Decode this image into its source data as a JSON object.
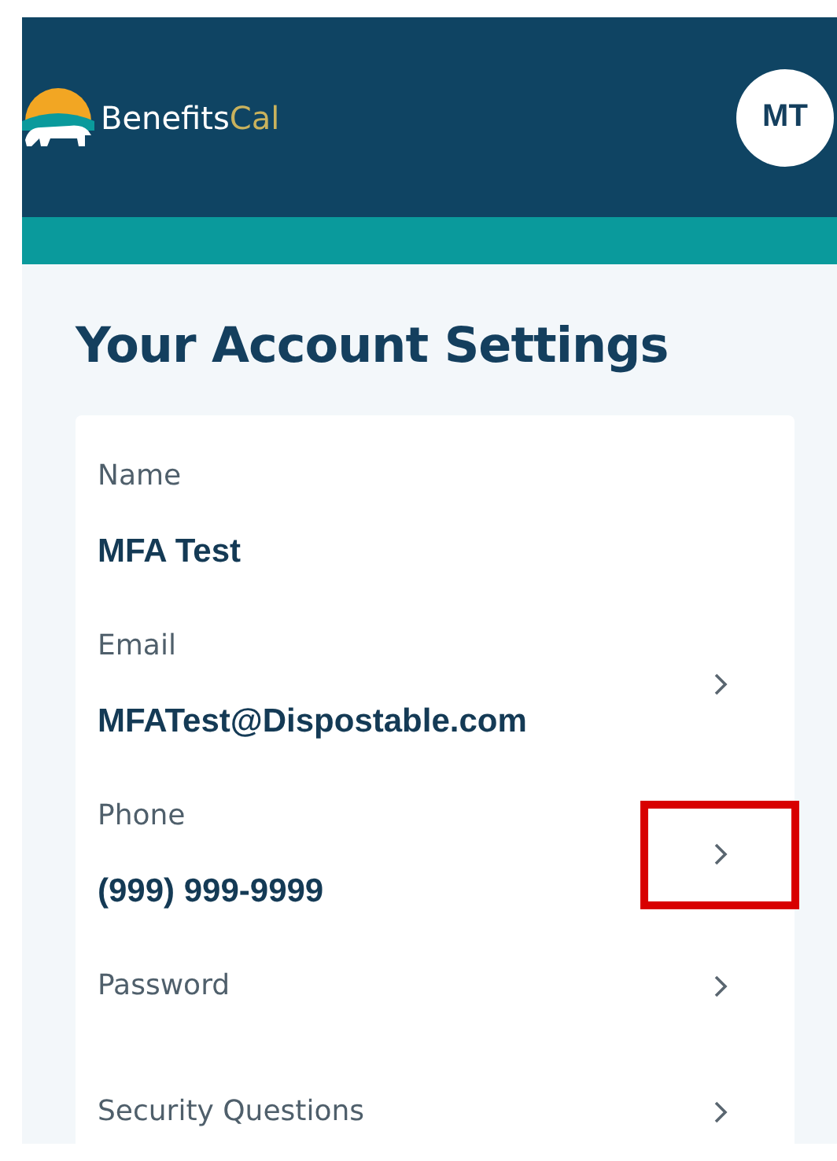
{
  "header": {
    "logo": {
      "text": "Benefits",
      "accent": "Cal"
    },
    "avatar": "MT"
  },
  "title": "Your Account Settings",
  "settings": [
    {
      "label": "Name",
      "value": "MFA Test",
      "link": false,
      "highlighted": false
    },
    {
      "label": "Email",
      "value": "MFATest@Dispostable.com",
      "link": true,
      "highlighted": false
    },
    {
      "label": "Phone",
      "value": "(999) 999-9999",
      "link": true,
      "highlighted": true
    },
    {
      "label": "Password",
      "link": true,
      "highlighted": false
    },
    {
      "label": "Security Questions",
      "link": true,
      "highlighted": false
    }
  ]
}
